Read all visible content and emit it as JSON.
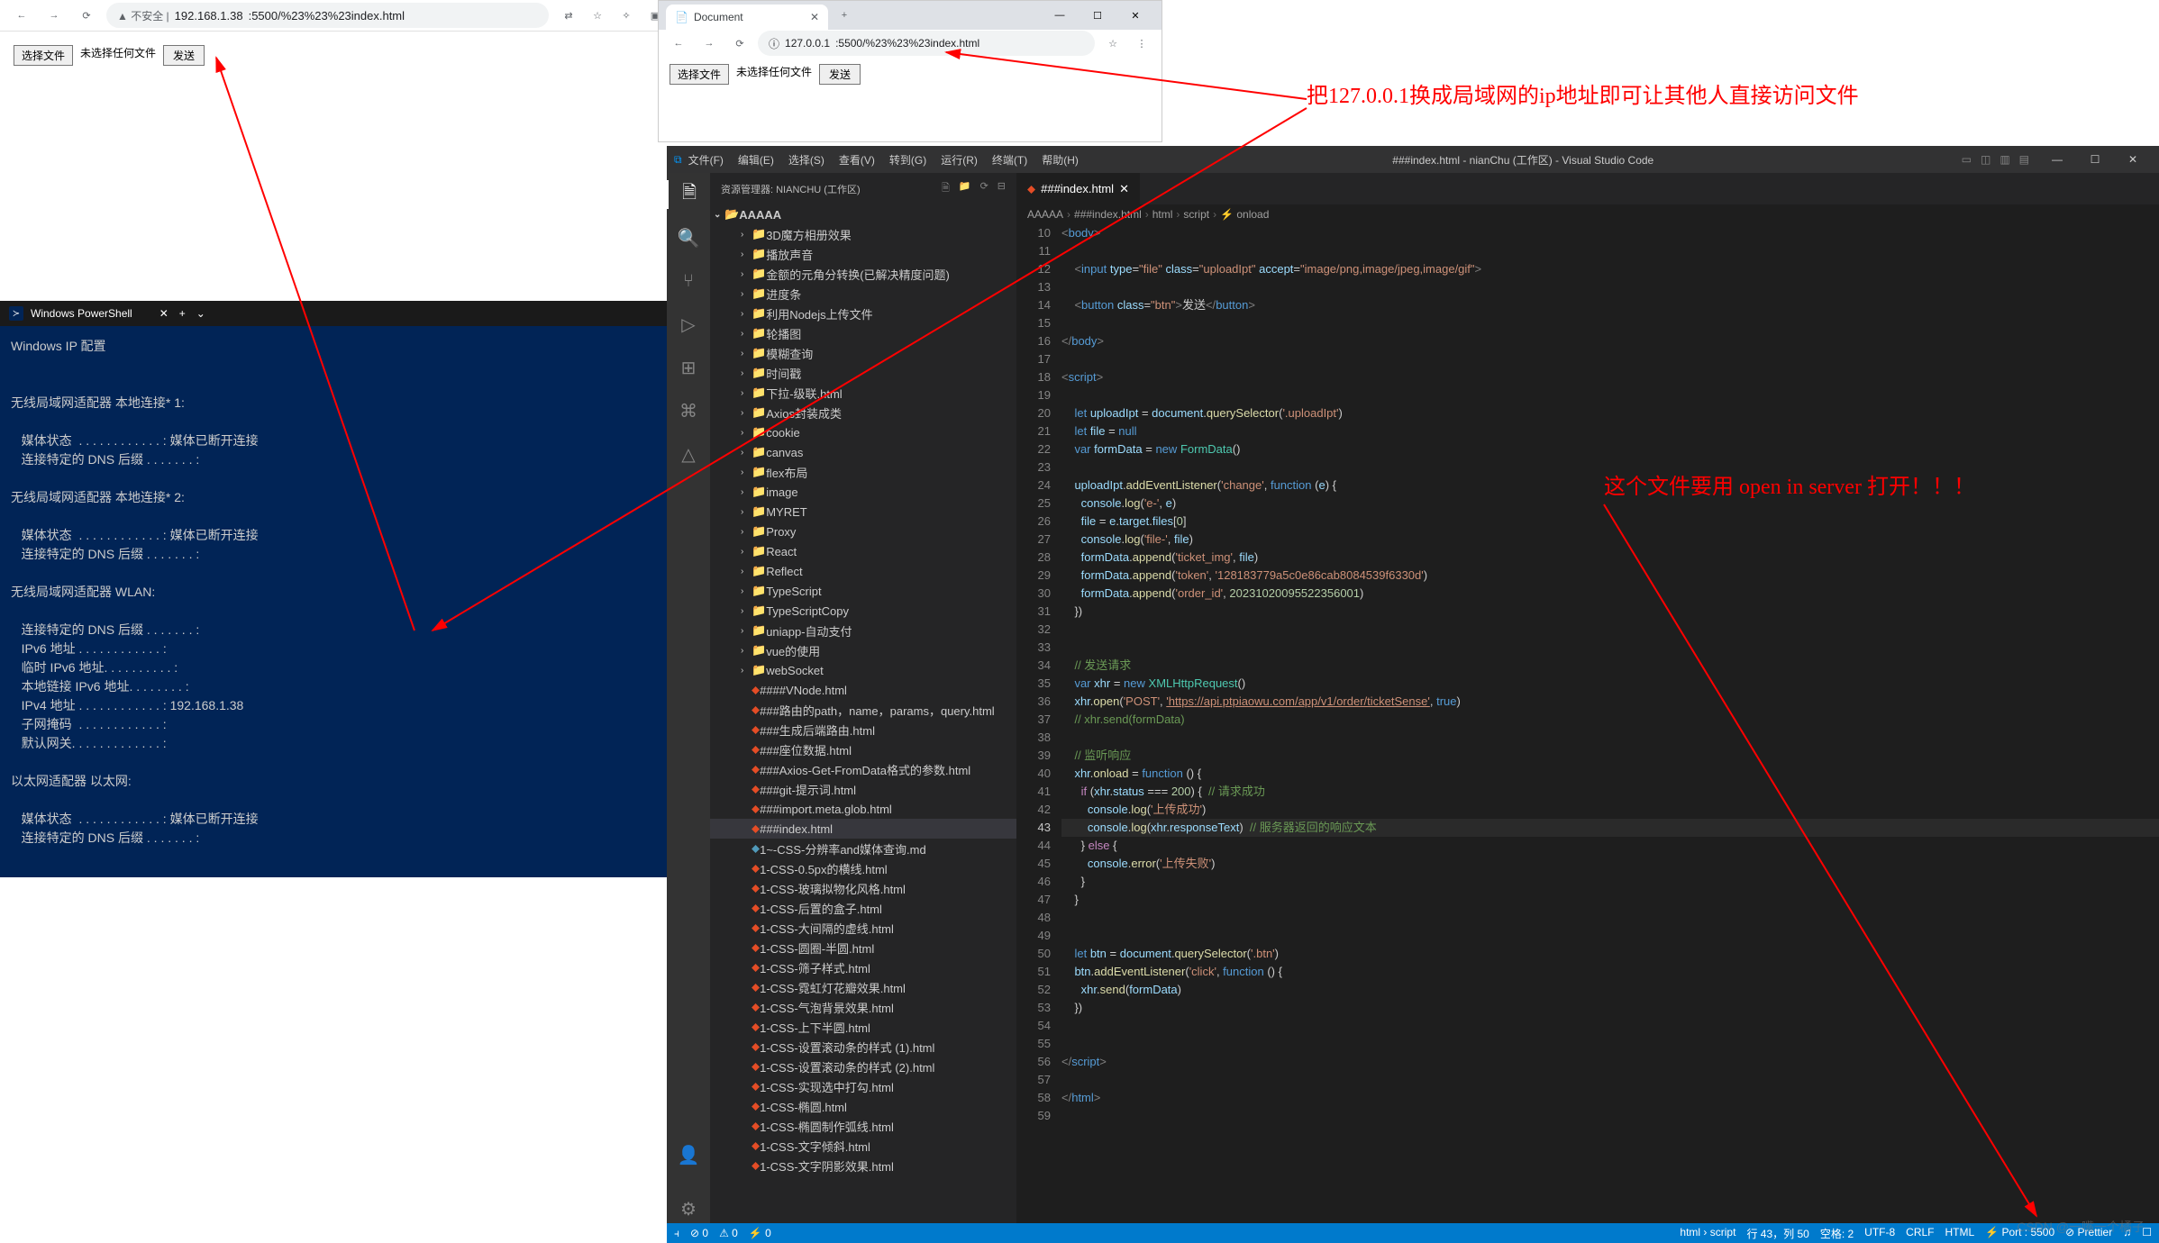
{
  "browser_left": {
    "nav_back": "←",
    "nav_fwd": "→",
    "nav_reload": "⟳",
    "url_warn": "▲ 不安全 |",
    "url_ip": "192.168.1.38",
    "url_rest": ":5500/%23%23%23index.html",
    "icons": [
      "⇄",
      "☆",
      "✧",
      "▣",
      "⋮"
    ],
    "file_btn": "选择文件",
    "file_label": "未选择任何文件",
    "send_btn": "发送"
  },
  "browser_right": {
    "tab_title": "Document",
    "win_min": "—",
    "win_max": "☐",
    "win_close": "✕",
    "newtab": "+",
    "nav_back": "←",
    "nav_fwd": "→",
    "nav_reload": "⟳",
    "url_info": "ⓘ",
    "url_ip": "127.0.0.1",
    "url_rest": ":5500/%23%23%23index.html",
    "icons": [
      "☆",
      "⋮"
    ],
    "file_btn": "选择文件",
    "file_label": "未选择任何文件",
    "send_btn": "发送"
  },
  "annotations": {
    "anno1": "把127.0.0.1换成局域网的ip地址即可让其他人直接访问文件",
    "anno2": "这个文件要用 open in server  打开！！！"
  },
  "powershell": {
    "title": "Windows PowerShell",
    "lines": [
      "Windows IP 配置",
      "",
      "",
      "无线局域网适配器 本地连接* 1:",
      "",
      "   媒体状态  . . . . . . . . . . . . : 媒体已断开连接",
      "   连接特定的 DNS 后缀 . . . . . . . :",
      "",
      "无线局域网适配器 本地连接* 2:",
      "",
      "   媒体状态  . . . . . . . . . . . . : 媒体已断开连接",
      "   连接特定的 DNS 后缀 . . . . . . . :",
      "",
      "无线局域网适配器 WLAN:",
      "",
      "   连接特定的 DNS 后缀 . . . . . . . :",
      "   IPv6 地址 . . . . . . . . . . . . : ",
      "   临时 IPv6 地址. . . . . . . . . . : ",
      "   本地链接 IPv6 地址. . . . . . . . : ",
      "   IPv4 地址 . . . . . . . . . . . . : 192.168.1.38",
      "   子网掩码  . . . . . . . . . . . . : ",
      "   默认网关. . . . . . . . . . . . . : ",
      "",
      "以太网适配器 以太网:",
      "",
      "   媒体状态  . . . . . . . . . . . . : 媒体已断开连接",
      "   连接特定的 DNS 后缀 . . . . . . . :"
    ]
  },
  "vscode": {
    "menus": [
      "文件(F)",
      "编辑(E)",
      "选择(S)",
      "查看(V)",
      "转到(G)",
      "运行(R)",
      "终端(T)",
      "帮助(H)"
    ],
    "title": "###index.html - nianChu (工作区) - Visual Studio Code",
    "sidebar_title": "资源管理器: NIANCHU (工作区)",
    "root": "AAAAA",
    "folders": [
      "3D魔方相册效果",
      "播放声音",
      "金额的元角分转换(已解决精度问题)",
      "进度条",
      "利用Nodejs上传文件",
      "轮播图",
      "模糊查询",
      "时间戳",
      "下拉-级联.html",
      "Axios封装成类",
      "cookie",
      "canvas",
      "flex布局",
      "image",
      "MYRET",
      "Proxy",
      "React",
      "Reflect",
      "TypeScript",
      "TypeScriptCopy",
      "uniapp-自动支付",
      "vue的使用",
      "webSocket"
    ],
    "files": [
      "####VNode.html",
      "###路由的path，name，params，query.html",
      "###生成后端路由.html",
      "###座位数据.html",
      "###Axios-Get-FromData格式的参数.html",
      "###git-提示词.html",
      "###import.meta.glob.html",
      "###index.html",
      "1~-CSS-分辨率and媒体查询.md",
      "1-CSS-0.5px的横线.html",
      "1-CSS-玻璃拟物化风格.html",
      "1-CSS-后置的盒子.html",
      "1-CSS-大间隔的虚线.html",
      "1-CSS-圆圈-半圆.html",
      "1-CSS-筛子样式.html",
      "1-CSS-霓虹灯花瓣效果.html",
      "1-CSS-气泡背景效果.html",
      "1-CSS-上下半圆.html",
      "1-CSS-设置滚动条的样式 (1).html",
      "1-CSS-设置滚动条的样式 (2).html",
      "1-CSS-实现选中打勾.html",
      "1-CSS-椭圆.html",
      "1-CSS-椭圆制作弧线.html",
      "1-CSS-文字倾斜.html",
      "1-CSS-文字阴影效果.html"
    ],
    "tab_name": "###index.html",
    "breadcrumb": [
      "AAAAA",
      "###index.html",
      "html",
      "script",
      "onload"
    ],
    "line_start": 10,
    "current_line": 43,
    "status_left": [
      "⊘ 0",
      "⚠ 0",
      "⚡ 0"
    ],
    "status_right": [
      "html › script",
      "行 43，列 50",
      "空格: 2",
      "UTF-8",
      "CRLF",
      "HTML",
      "⚡ Port : 5500",
      "⊘ Prettier",
      "♫",
      "☐"
    ]
  },
  "watermark": "CSDN @一嘴一个橘子"
}
